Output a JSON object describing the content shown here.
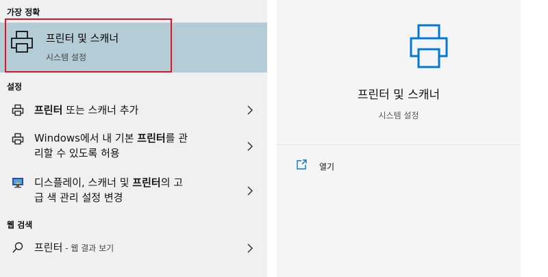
{
  "left": {
    "best_match_header": "가장 정확",
    "best_match": {
      "title": "프린터 및 스캐너",
      "subtitle": "시스템 설정",
      "icon": "printer-icon"
    },
    "settings_header": "설정",
    "settings_results": [
      {
        "icon": "printer-small-icon",
        "line1": [
          {
            "t": "프린터",
            "b": true
          },
          {
            "t": " 또는 스캐너 추가",
            "b": false
          }
        ],
        "line2": []
      },
      {
        "icon": "printer-small-icon",
        "line1": [
          {
            "t": "Windows에서 내 기본 ",
            "b": false
          },
          {
            "t": "프린터",
            "b": true
          },
          {
            "t": "를 관",
            "b": false
          }
        ],
        "line2": [
          {
            "t": "리할 수 있도록 허용",
            "b": false
          }
        ]
      },
      {
        "icon": "display-icon",
        "line1": [
          {
            "t": "디스플레이, 스캐너 및 ",
            "b": false
          },
          {
            "t": "프린터",
            "b": true
          },
          {
            "t": "의 고",
            "b": false
          }
        ],
        "line2": [
          {
            "t": "급 색 관리 설정 변경",
            "b": false
          }
        ]
      }
    ],
    "web_header": "웹 검색",
    "web_result": {
      "query": "프린터",
      "suffix": " - 웹 결과 보기",
      "icon": "search-icon"
    }
  },
  "preview": {
    "icon": "printer-icon",
    "title": "프린터 및 스캐너",
    "subtitle": "시스템 설정",
    "actions": [
      {
        "icon": "open-icon",
        "label": "열기"
      }
    ]
  },
  "colors": {
    "accent": "#0078d4",
    "selection": "#b3ccd6",
    "highlight_border": "#e81123"
  }
}
